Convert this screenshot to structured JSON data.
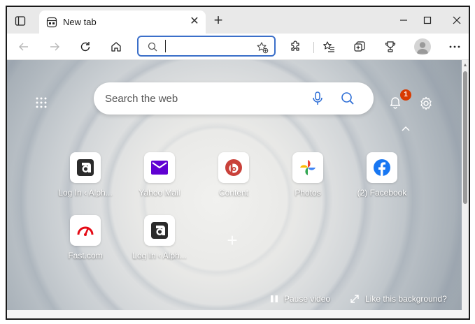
{
  "browser": {
    "tab": {
      "title": "New tab",
      "favicon": "newtab-page-icon",
      "close_icon": "close-icon"
    },
    "window_controls": [
      "minimize-icon",
      "maximize-icon",
      "close-icon"
    ]
  },
  "toolbar": {
    "address": {
      "placeholder": "",
      "value": ""
    }
  },
  "newtab": {
    "search_placeholder": "Search the web",
    "notification_count": "1",
    "tiles": [
      {
        "label": "Log In ‹ Alph...",
        "icon": "alph-logo-icon"
      },
      {
        "label": "Yahoo Mail",
        "icon": "yahoo-mail-icon"
      },
      {
        "label": "Content",
        "icon": "content-icon"
      },
      {
        "label": "Photos",
        "icon": "google-photos-icon"
      },
      {
        "label": "(2) Facebook",
        "icon": "facebook-icon"
      },
      {
        "label": "Fast.com",
        "icon": "fast-com-icon"
      },
      {
        "label": "Log In ‹ Alph...",
        "icon": "alph-logo-icon"
      }
    ],
    "pause_video": "Pause video",
    "like_background": "Like this background?"
  },
  "colors": {
    "accent": "#3b6fc9",
    "badge": "#d83b01",
    "facebook": "#1877f2",
    "yahoo": "#6001d2"
  }
}
